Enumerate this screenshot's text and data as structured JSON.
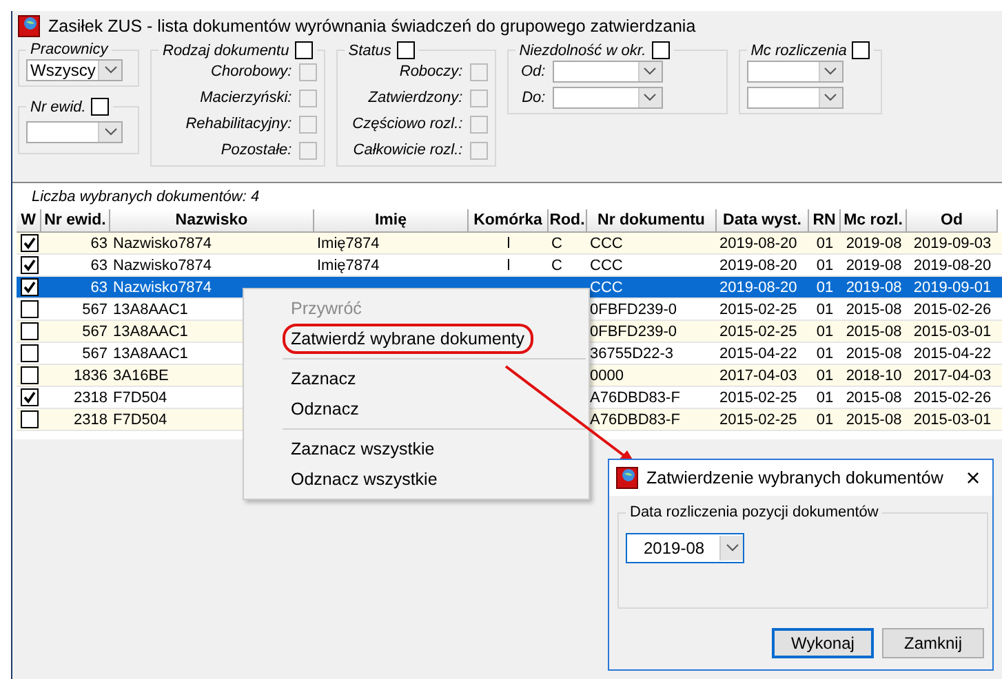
{
  "window": {
    "title": "Zasiłek ZUS - lista dokumentów wyrównania świadczeń do grupowego zatwierdzania"
  },
  "filters": {
    "employees": {
      "label": "Pracownicy",
      "value": "Wszyscy"
    },
    "record_no": {
      "label": "Nr ewid.",
      "checked": false
    },
    "doc_type": {
      "label": "Rodzaj dokumentu",
      "checked": false,
      "items": [
        {
          "label": "Chorobowy:",
          "checked": false
        },
        {
          "label": "Macierzyński:",
          "checked": false
        },
        {
          "label": "Rehabilitacyjny:",
          "checked": false
        },
        {
          "label": "Pozostałe:",
          "checked": false
        }
      ]
    },
    "status": {
      "label": "Status",
      "checked": false,
      "items": [
        {
          "label": "Roboczy:",
          "checked": false
        },
        {
          "label": "Zatwierdzony:",
          "checked": false
        },
        {
          "label": "Częściowo rozl.:",
          "checked": false
        },
        {
          "label": "Całkowicie rozl.:",
          "checked": false
        }
      ]
    },
    "incapacity": {
      "label": "Niezdolność w okr.",
      "checked": false,
      "fields": [
        {
          "label": "Od:"
        },
        {
          "label": "Do:"
        }
      ]
    },
    "settlement_month": {
      "label": "Mc rozliczenia",
      "checked": false
    }
  },
  "selected_count": "Liczba wybranych dokumentów:  4",
  "table": {
    "columns": [
      "W",
      "Nr ewid.",
      "Nazwisko",
      "Imię",
      "Komórka",
      "Rod.",
      "Nr dokumentu",
      "Data wyst.",
      "RN",
      "Mc rozl.",
      "Od"
    ],
    "rows": [
      {
        "checked": true,
        "selected": false,
        "cells": [
          "",
          "63",
          "Nazwisko7874",
          "Imię7874",
          "l",
          "C",
          "CCC",
          "2019-08-20",
          "01",
          "2019-08",
          "2019-09-03"
        ]
      },
      {
        "checked": true,
        "selected": false,
        "cells": [
          "",
          "63",
          "Nazwisko7874",
          "Imię7874",
          "l",
          "C",
          "CCC",
          "2019-08-20",
          "01",
          "2019-08",
          "2019-08-20"
        ]
      },
      {
        "checked": true,
        "selected": true,
        "cells": [
          "",
          "63",
          "Nazwisko7874",
          null,
          null,
          null,
          "CCC",
          "2019-08-20",
          "01",
          "2019-08",
          "2019-09-01"
        ]
      },
      {
        "checked": false,
        "selected": false,
        "cells": [
          "",
          "567",
          "13A8AAC1",
          null,
          null,
          null,
          "0FBFD239-0",
          "2015-02-25",
          "01",
          "2015-08",
          "2015-02-26"
        ]
      },
      {
        "checked": false,
        "selected": false,
        "cells": [
          "",
          "567",
          "13A8AAC1",
          null,
          null,
          null,
          "0FBFD239-0",
          "2015-02-25",
          "01",
          "2015-08",
          "2015-03-01"
        ]
      },
      {
        "checked": false,
        "selected": false,
        "cells": [
          "",
          "567",
          "13A8AAC1",
          null,
          null,
          null,
          "36755D22-3",
          "2015-04-22",
          "01",
          "2015-08",
          "2015-04-22"
        ]
      },
      {
        "checked": false,
        "selected": false,
        "cells": [
          "",
          "1836",
          "3A16BE",
          null,
          null,
          null,
          "0000",
          "2017-04-03",
          "01",
          "2018-10",
          "2017-04-03"
        ]
      },
      {
        "checked": true,
        "selected": false,
        "cells": [
          "",
          "2318",
          "F7D504",
          null,
          null,
          null,
          "A76DBD83-F",
          "2015-02-25",
          "01",
          "2015-08",
          "2015-02-26"
        ]
      },
      {
        "checked": false,
        "selected": false,
        "cells": [
          "",
          "2318",
          "F7D504",
          null,
          null,
          null,
          "A76DBD83-F",
          "2015-02-25",
          "01",
          "2015-08",
          "2015-03-01"
        ]
      }
    ]
  },
  "context_menu": {
    "items": [
      {
        "kind": "item",
        "label": "Przywróć",
        "disabled": true,
        "annotated": false
      },
      {
        "kind": "item",
        "label": "Zatwierdź wybrane dokumenty",
        "disabled": false,
        "annotated": true
      },
      {
        "kind": "separator"
      },
      {
        "kind": "item",
        "label": "Zaznacz",
        "disabled": false,
        "annotated": false
      },
      {
        "kind": "item",
        "label": "Odznacz",
        "disabled": false,
        "annotated": false
      },
      {
        "kind": "separator"
      },
      {
        "kind": "item",
        "label": "Zaznacz wszystkie",
        "disabled": false,
        "annotated": false
      },
      {
        "kind": "item",
        "label": "Odznacz wszystkie",
        "disabled": false,
        "annotated": false
      }
    ]
  },
  "dialog": {
    "title": "Zatwierdzenie wybranych dokumentów",
    "close": "×",
    "group_label": "Data rozliczenia pozycji dokumentów",
    "value": "2019-08",
    "buttons": [
      {
        "label": "Wykonaj",
        "focused": true
      },
      {
        "label": "Zamknij",
        "focused": false
      }
    ]
  }
}
